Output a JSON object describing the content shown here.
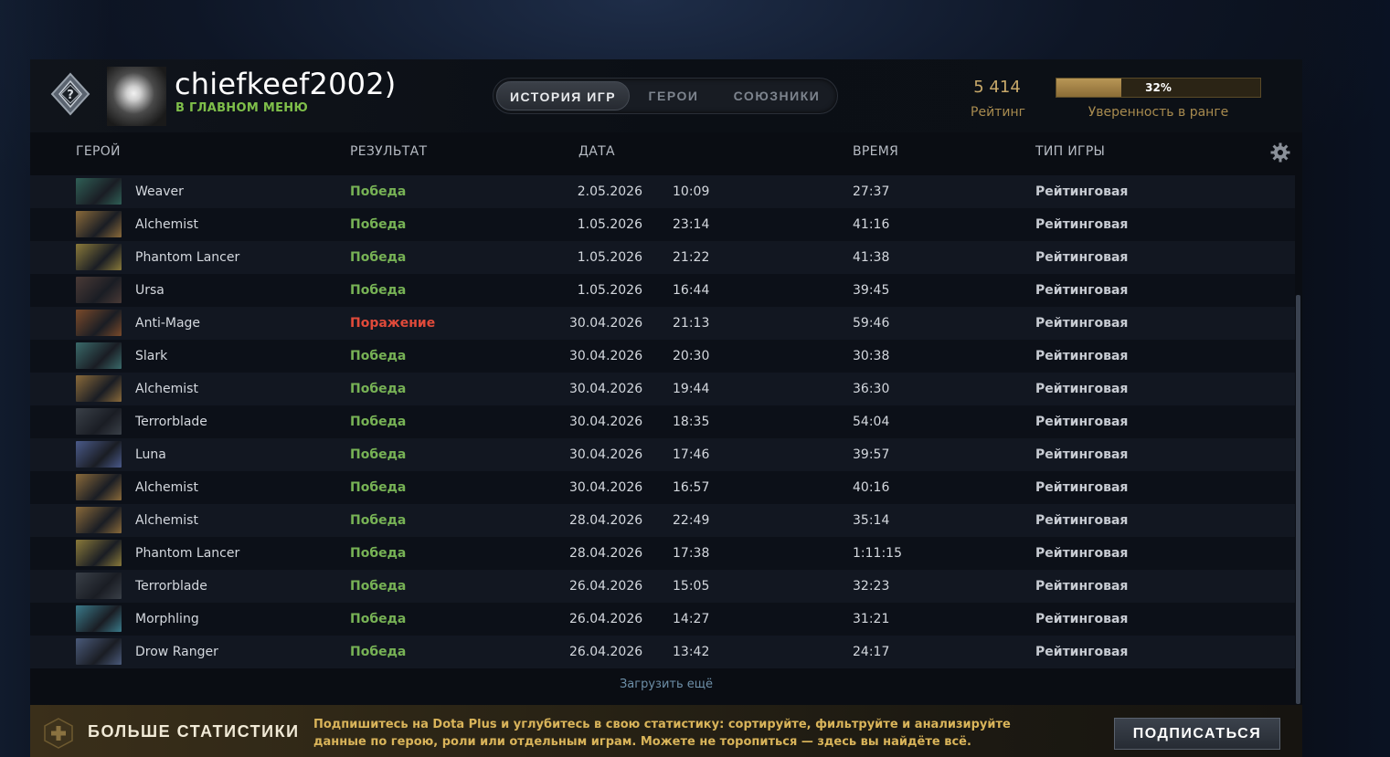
{
  "player": {
    "name": "chiefkeef2002)",
    "status": "В ГЛАВНОМ МЕНЮ"
  },
  "tabs": [
    {
      "label": "ИСТОРИЯ ИГР",
      "active": true
    },
    {
      "label": "ГЕРОИ",
      "active": false
    },
    {
      "label": "СОЮЗНИКИ",
      "active": false
    }
  ],
  "rating": {
    "value": "5 414",
    "label": "Рейтинг"
  },
  "confidence": {
    "percent_text": "32%",
    "fraction": 0.32,
    "label": "Уверенность в ранге"
  },
  "columns": {
    "hero": "ГЕРОЙ",
    "result": "РЕЗУЛЬТАТ",
    "date": "ДАТА",
    "duration": "ВРЕМЯ",
    "mode": "ТИП ИГРЫ"
  },
  "matches": [
    {
      "hero": "Weaver",
      "result": "Победа",
      "win": true,
      "date": "2.05.2026",
      "time": "10:09",
      "duration": "27:37",
      "mode": "Рейтинговая",
      "icon_color": "#2f5f56"
    },
    {
      "hero": "Alchemist",
      "result": "Победа",
      "win": true,
      "date": "1.05.2026",
      "time": "23:14",
      "duration": "41:16",
      "mode": "Рейтинговая",
      "icon_color": "#8a6a3a"
    },
    {
      "hero": "Phantom Lancer",
      "result": "Победа",
      "win": true,
      "date": "1.05.2026",
      "time": "21:22",
      "duration": "41:38",
      "mode": "Рейтинговая",
      "icon_color": "#8a7a3a"
    },
    {
      "hero": "Ursa",
      "result": "Победа",
      "win": true,
      "date": "1.05.2026",
      "time": "16:44",
      "duration": "39:45",
      "mode": "Рейтинговая",
      "icon_color": "#4a3a36"
    },
    {
      "hero": "Anti-Mage",
      "result": "Поражение",
      "win": false,
      "date": "30.04.2026",
      "time": "21:13",
      "duration": "59:46",
      "mode": "Рейтинговая",
      "icon_color": "#7a4a2a"
    },
    {
      "hero": "Slark",
      "result": "Победа",
      "win": true,
      "date": "30.04.2026",
      "time": "20:30",
      "duration": "30:38",
      "mode": "Рейтинговая",
      "icon_color": "#3a6a6a"
    },
    {
      "hero": "Alchemist",
      "result": "Победа",
      "win": true,
      "date": "30.04.2026",
      "time": "19:44",
      "duration": "36:30",
      "mode": "Рейтинговая",
      "icon_color": "#8a6a3a"
    },
    {
      "hero": "Terrorblade",
      "result": "Победа",
      "win": true,
      "date": "30.04.2026",
      "time": "18:35",
      "duration": "54:04",
      "mode": "Рейтинговая",
      "icon_color": "#3a4048"
    },
    {
      "hero": "Luna",
      "result": "Победа",
      "win": true,
      "date": "30.04.2026",
      "time": "17:46",
      "duration": "39:57",
      "mode": "Рейтинговая",
      "icon_color": "#4a5a8a"
    },
    {
      "hero": "Alchemist",
      "result": "Победа",
      "win": true,
      "date": "30.04.2026",
      "time": "16:57",
      "duration": "40:16",
      "mode": "Рейтинговая",
      "icon_color": "#8a6a3a"
    },
    {
      "hero": "Alchemist",
      "result": "Победа",
      "win": true,
      "date": "28.04.2026",
      "time": "22:49",
      "duration": "35:14",
      "mode": "Рейтинговая",
      "icon_color": "#8a6a3a"
    },
    {
      "hero": "Phantom Lancer",
      "result": "Победа",
      "win": true,
      "date": "28.04.2026",
      "time": "17:38",
      "duration": "1:11:15",
      "mode": "Рейтинговая",
      "icon_color": "#8a7a3a"
    },
    {
      "hero": "Terrorblade",
      "result": "Победа",
      "win": true,
      "date": "26.04.2026",
      "time": "15:05",
      "duration": "32:23",
      "mode": "Рейтинговая",
      "icon_color": "#3a4048"
    },
    {
      "hero": "Morphling",
      "result": "Победа",
      "win": true,
      "date": "26.04.2026",
      "time": "14:27",
      "duration": "31:21",
      "mode": "Рейтинговая",
      "icon_color": "#3a7a8a"
    },
    {
      "hero": "Drow Ranger",
      "result": "Победа",
      "win": true,
      "date": "26.04.2026",
      "time": "13:42",
      "duration": "24:17",
      "mode": "Рейтинговая",
      "icon_color": "#4a5a7a"
    }
  ],
  "load_more": "Загрузить ещё",
  "promo": {
    "title": "БОЛЬШЕ СТАТИСТИКИ",
    "text": "Подпишитесь на Dota Plus и углубитесь в свою статистику: сортируйте, фильтруйте и анализируйте данные по герою, роли или отдельным играм. Можете не торопиться — здесь вы найдёте всё.",
    "button": "ПОДПИСАТЬСЯ"
  },
  "colors": {
    "win": "#77b255",
    "loss": "#e04a3a",
    "gold": "#c8a96a",
    "status_green": "#7fbf4a"
  },
  "icons": {
    "rank": "rank-medal-unknown-icon",
    "settings": "gear-icon",
    "promo": "dota-plus-icon"
  }
}
